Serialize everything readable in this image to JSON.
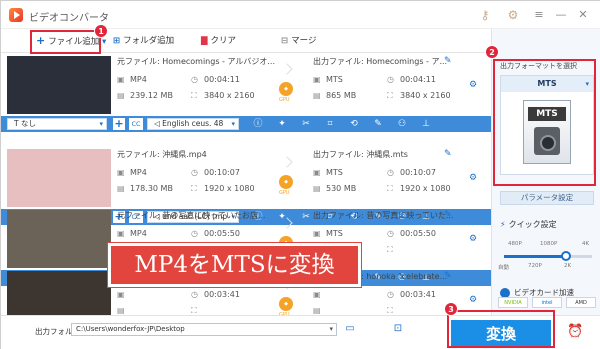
{
  "app": {
    "title": "ビデオコンバータ"
  },
  "toolbar": {
    "add_file": "ファイル追加",
    "add_folder": "フォルダ追加",
    "clear": "クリア",
    "merge": "マージ"
  },
  "files": [
    {
      "source": "元ファイル: Homecomings - アルバジオ...",
      "output": "出力ファイル: Homecomings - ア...",
      "in_format": "MP4",
      "in_duration": "00:04:11",
      "in_size": "239.12 MB",
      "in_resolution": "3840 x 2160",
      "out_format": "MTS",
      "out_duration": "00:04:11",
      "out_size": "865 MB",
      "out_resolution": "3840 x 2160",
      "subtitle": "なし",
      "audio": "English ceus. 48",
      "thumb": "#2b2f3a"
    },
    {
      "source": "元ファイル: 沖縄県.mp4",
      "output": "出力ファイル: 沖縄県.mts",
      "in_format": "MP4",
      "in_duration": "00:10:07",
      "in_size": "178.30 MB",
      "in_resolution": "1920 x 1080",
      "out_format": "MTS",
      "out_duration": "00:10:07",
      "out_size": "530 MB",
      "out_resolution": "1920 x 1080",
      "subtitle": "なし",
      "audio": "und aac (LC) (mp",
      "thumb": "#e8bfc1"
    },
    {
      "source": "元ファイル: 昔の写真に映っていたお店...",
      "output": "出力ファイル: 昔の写真に映っていた...",
      "in_format": "MP4",
      "in_duration": "00:05:50",
      "in_size": "",
      "in_resolution": "",
      "out_format": "MTS",
      "out_duration": "00:05:50",
      "out_size": "",
      "out_resolution": "",
      "subtitle": "なし",
      "audio": "",
      "thumb": "#6b6258"
    },
    {
      "source": "元ファイル: honoka \"celebrateホロコ...",
      "output": "出力ファイル: honoka \"celebrate...",
      "in_format": "",
      "in_duration": "00:03:41",
      "in_size": "",
      "in_resolution": "",
      "out_format": "",
      "out_duration": "00:03:41",
      "out_size": "",
      "out_resolution": "",
      "subtitle": "",
      "audio": "",
      "thumb": "#3d3630"
    }
  ],
  "gpu_label": "GPU",
  "right_panel": {
    "format_label": "出力フォーマットを選択",
    "format_value": "MTS",
    "format_icon_text": "MTS",
    "param_button": "パラメータ設定",
    "quick_label": "クイック設定",
    "ticks_top": [
      "480P",
      "1080P",
      "4K"
    ],
    "ticks_bottom": [
      "自動",
      "720P",
      "2K"
    ],
    "gpu_accel": "ビデオカード加速",
    "vendors": [
      "NVIDIA",
      "intel",
      "AMD"
    ],
    "quality_level": 0.7
  },
  "bottom": {
    "output_label": "出力フォルダ:",
    "output_path": "C:\\Users\\wonderfox-JP\\Desktop",
    "convert": "変換"
  },
  "callouts": [
    "1",
    "2",
    "3"
  ],
  "banner": "MP4をMTSに変換",
  "colors": {
    "accent": "#1b70c8",
    "highlight": "#e0263a",
    "banner": "#e2453d",
    "convert": "#1b8fe5"
  }
}
